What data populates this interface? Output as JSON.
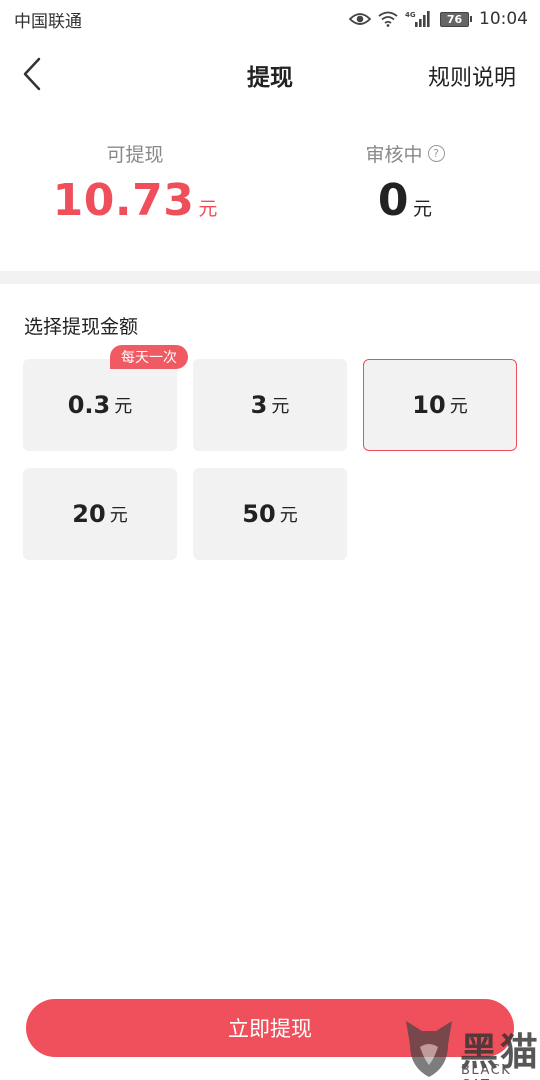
{
  "status_bar": {
    "carrier": "中国联通",
    "network": "4G",
    "battery": "76",
    "time": "10:04"
  },
  "nav": {
    "title": "提现",
    "rules": "规则说明"
  },
  "balance": {
    "available_label": "可提现",
    "available_value": "10.73",
    "available_unit": "元",
    "pending_label": "审核中",
    "pending_value": "0",
    "pending_unit": "元"
  },
  "amounts": {
    "title": "选择提现金额",
    "options": [
      {
        "value": "0.3",
        "unit": "元",
        "badge": "每天一次",
        "selected": false
      },
      {
        "value": "3",
        "unit": "元",
        "selected": false
      },
      {
        "value": "10",
        "unit": "元",
        "selected": true
      },
      {
        "value": "20",
        "unit": "元",
        "selected": false
      },
      {
        "value": "50",
        "unit": "元",
        "selected": false
      }
    ]
  },
  "action": {
    "withdraw_label": "立即提现"
  },
  "watermark": {
    "text": "黑猫",
    "subtext": "BLACK CAT"
  },
  "colors": {
    "accent": "#ef4f5a",
    "option_bg": "#f2f2f2"
  },
  "icons": {
    "back": "chevron-left-icon",
    "help": "question-circle-icon",
    "eye": "eye-icon",
    "wifi": "wifi-icon",
    "signal": "signal-icon",
    "battery": "battery-icon"
  }
}
